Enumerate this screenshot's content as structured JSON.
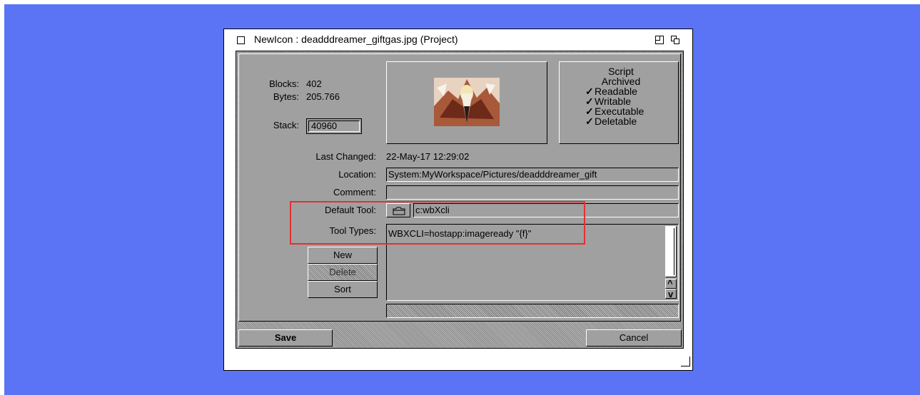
{
  "window": {
    "title": "NewIcon : deadddreamer_giftgas.jpg (Project)"
  },
  "info": {
    "blocks_label": "Blocks:",
    "blocks_value": "402",
    "bytes_label": "Bytes:",
    "bytes_value": "205.766",
    "stack_label": "Stack:",
    "stack_value": "40960"
  },
  "attributes": [
    {
      "label": "Script",
      "checked": false
    },
    {
      "label": "Archived",
      "checked": false
    },
    {
      "label": "Readable",
      "checked": true
    },
    {
      "label": "Writable",
      "checked": true
    },
    {
      "label": "Executable",
      "checked": true
    },
    {
      "label": "Deletable",
      "checked": true
    }
  ],
  "details": {
    "last_changed_label": "Last Changed:",
    "last_changed_value": "22-May-17 12:29:02",
    "location_label": "Location:",
    "location_value": "System:MyWorkspace/Pictures/deadddreamer_gift",
    "comment_label": "Comment:",
    "comment_value": "",
    "default_tool_label": "Default Tool:",
    "default_tool_value": "c:wbXcli",
    "tool_types_label": "Tool Types:"
  },
  "tool_types": {
    "items": [
      "WBXCLI=hostapp:imageready \"{f}\""
    ],
    "new_label": "New",
    "delete_label": "Delete",
    "sort_label": "Sort"
  },
  "footer": {
    "save_label": "Save",
    "cancel_label": "Cancel"
  },
  "colors": {
    "desktop": "#5b73f5",
    "panel": "#a0a0a0",
    "highlight": "#e53030"
  }
}
